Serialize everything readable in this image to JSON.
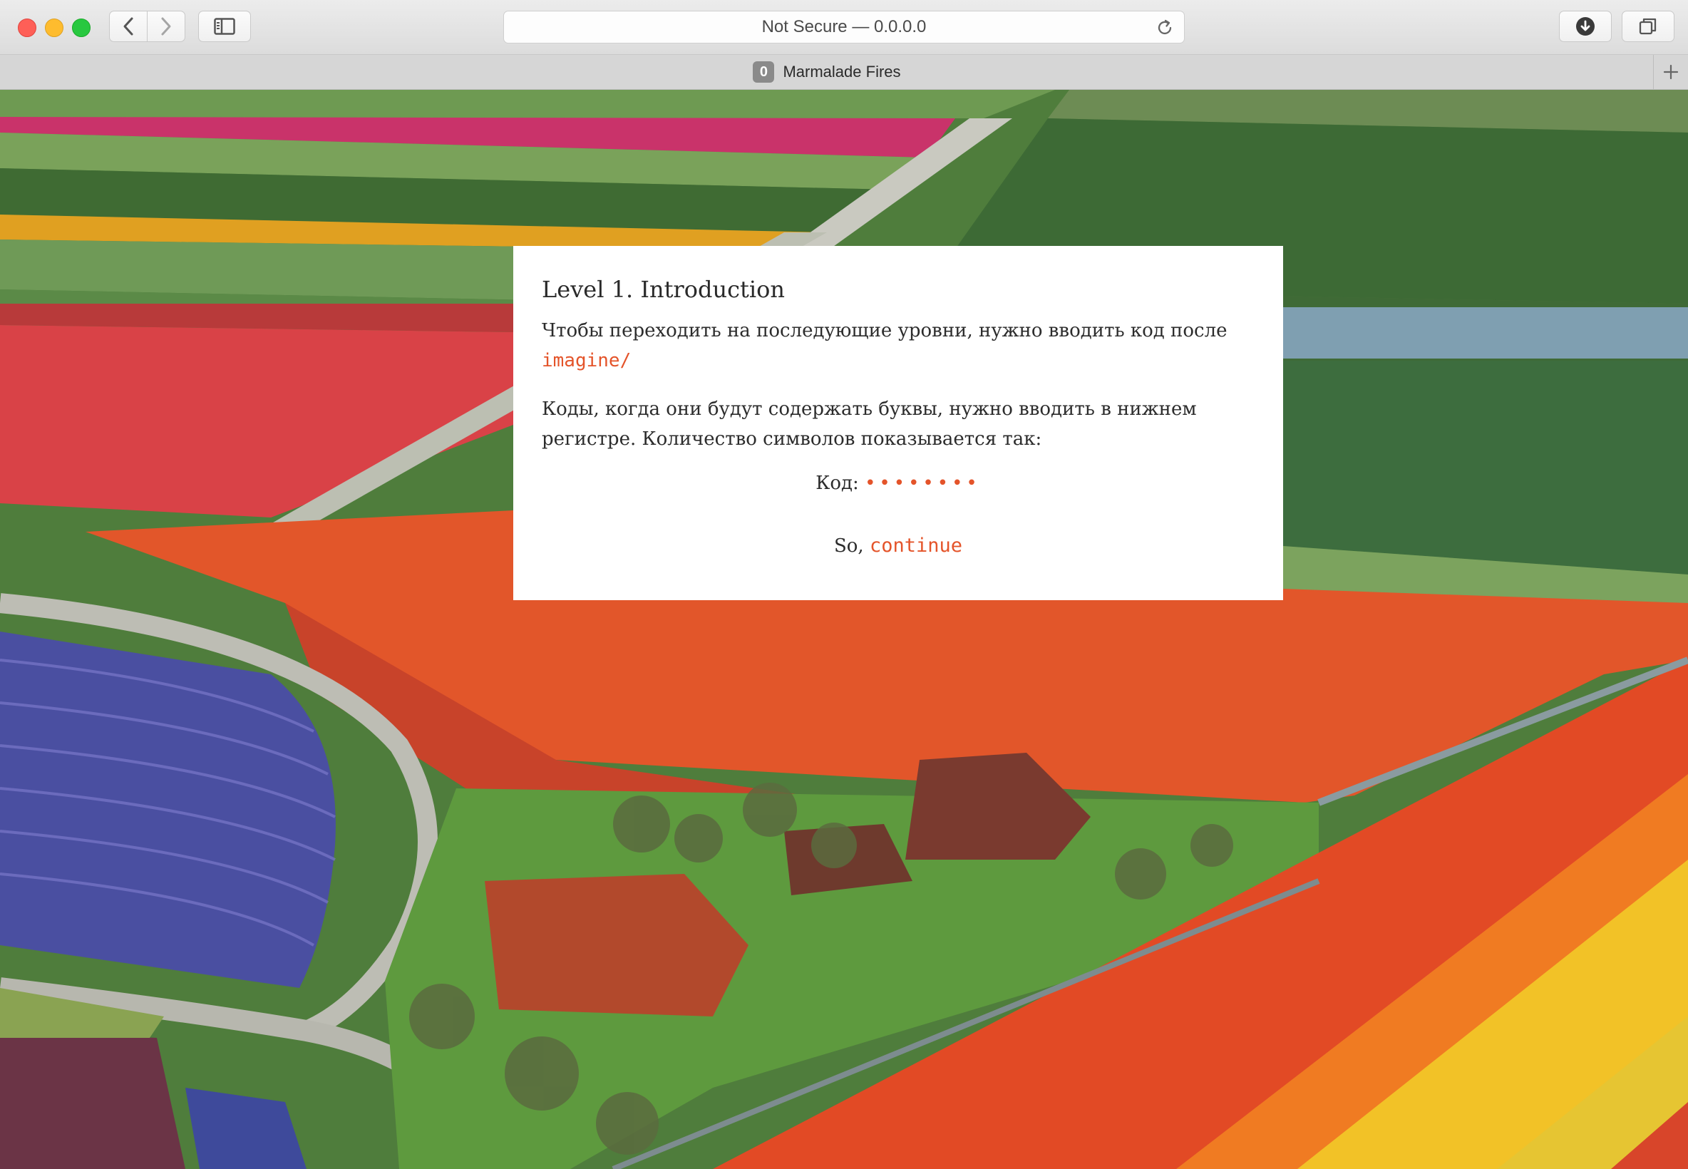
{
  "browser": {
    "address_text": "Not Secure — 0.0.0.0",
    "tab_badge": "0",
    "tab_title": "Marmalade Fires"
  },
  "dialog": {
    "heading": "Level 1. Introduction",
    "para1": "Чтобы переходить на последующие уровни, нужно вводить код после",
    "code_path": "imagine/",
    "para2": "Коды, когда они будут содержать буквы, нужно вводить в нижнем регистре. Количество символов показывается так:",
    "code_label": "Код:",
    "code_mask": "••••••••",
    "so_text": "So,",
    "continue_link": "continue"
  },
  "colors": {
    "accent": "#e4542a",
    "dialog_bg": "#ffffff"
  },
  "icons": [
    "back-chevron-icon",
    "forward-chevron-icon",
    "sidebar-icon",
    "reload-icon",
    "download-icon",
    "tabs-overview-icon",
    "new-tab-plus-icon"
  ]
}
